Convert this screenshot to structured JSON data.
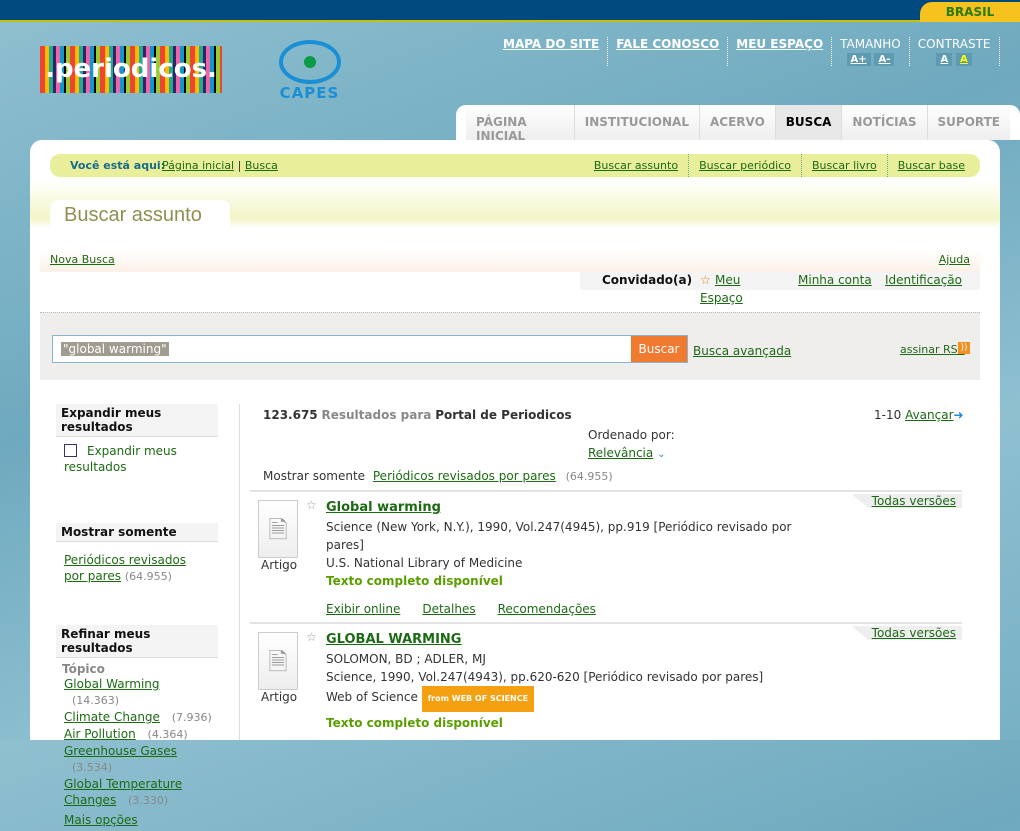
{
  "header": {
    "brasil": "BRASIL",
    "logo": ".periodicos.",
    "capes": "CAPES",
    "links": [
      "MAPA DO SITE",
      "FALE CONOSCO",
      "MEU ESPAÇO"
    ],
    "tamanho": "TAMANHO",
    "a_plus": "A+",
    "a_minus": "A-",
    "contraste": "CONTRASTE",
    "c1": "A",
    "c2": "A"
  },
  "tabs": [
    "PÁGINA INICIAL",
    "INSTITUCIONAL",
    "ACERVO",
    "BUSCA",
    "NOTÍCIAS",
    "SUPORTE"
  ],
  "breadcrumb": {
    "label": "Você está aqui:",
    "items": [
      "Página inicial",
      "Busca"
    ],
    "sep": "|",
    "quick": [
      "Buscar assunto",
      "Buscar periódico",
      "Buscar livro",
      "Buscar base"
    ]
  },
  "page_title": "Buscar assunto",
  "nova_busca": "Nova Busca",
  "ajuda": "Ajuda",
  "user": {
    "name": "Convidado(a)",
    "meu": "Meu",
    "espaco": "Espaço",
    "conta": "Minha conta",
    "ident": "Identificação"
  },
  "search": {
    "value": "\"global warming\"",
    "button": "Buscar",
    "advanced": "Busca avançada",
    "rss": "assinar RSS"
  },
  "sidebar": {
    "expand_title": "Expandir meus resultados",
    "expand_label": "Expandir meus resultados",
    "show_title": "Mostrar somente",
    "peer": "Periódicos revisados por pares",
    "peer_count": "(64.955)",
    "refine_title": "Refinar meus resultados",
    "topic": "Tópico",
    "topics": [
      {
        "label": "Global Warming",
        "count": "(14.363)"
      },
      {
        "label": "Climate Change",
        "count": "(7.936)"
      },
      {
        "label": "Air Pollution",
        "count": "(4.364)"
      },
      {
        "label": "Greenhouse Gases",
        "count": "(3.534)"
      },
      {
        "label": "Global Temperature Changes",
        "count": "(3.330)"
      }
    ],
    "more": "Mais opções"
  },
  "results": {
    "count": "123.675",
    "label": "Resultados para",
    "source": "Portal de Periodicos",
    "range": "1-10",
    "next": "Avançar",
    "sort_label": "Ordenado por:",
    "sort": "Relevância",
    "show_only": "Mostrar somente",
    "peer": "Periódicos revisados por pares",
    "peer_count": "(64.955)",
    "items": [
      {
        "title": "Global warming",
        "lines": [
          "Science (New York, N.Y.), 1990, Vol.247(4945), pp.919 [Periódico revisado por pares]",
          "U.S. National Library of Medicine"
        ],
        "type": "Artigo",
        "fulltext": "Texto completo disponível",
        "versions": "Todas versões",
        "actions": [
          "Exibir online",
          "Detalhes",
          "Recomendações"
        ]
      },
      {
        "title": "GLOBAL WARMING",
        "lines": [
          "SOLOMON, BD ; ADLER, MJ",
          "Science, 1990, Vol.247(4943), pp.620-620 [Periódico revisado por pares]",
          "Web of Science"
        ],
        "badge": "from WEB OF SCIENCE",
        "type": "Artigo",
        "fulltext": "Texto completo disponível",
        "versions": "Todas versões"
      }
    ]
  }
}
